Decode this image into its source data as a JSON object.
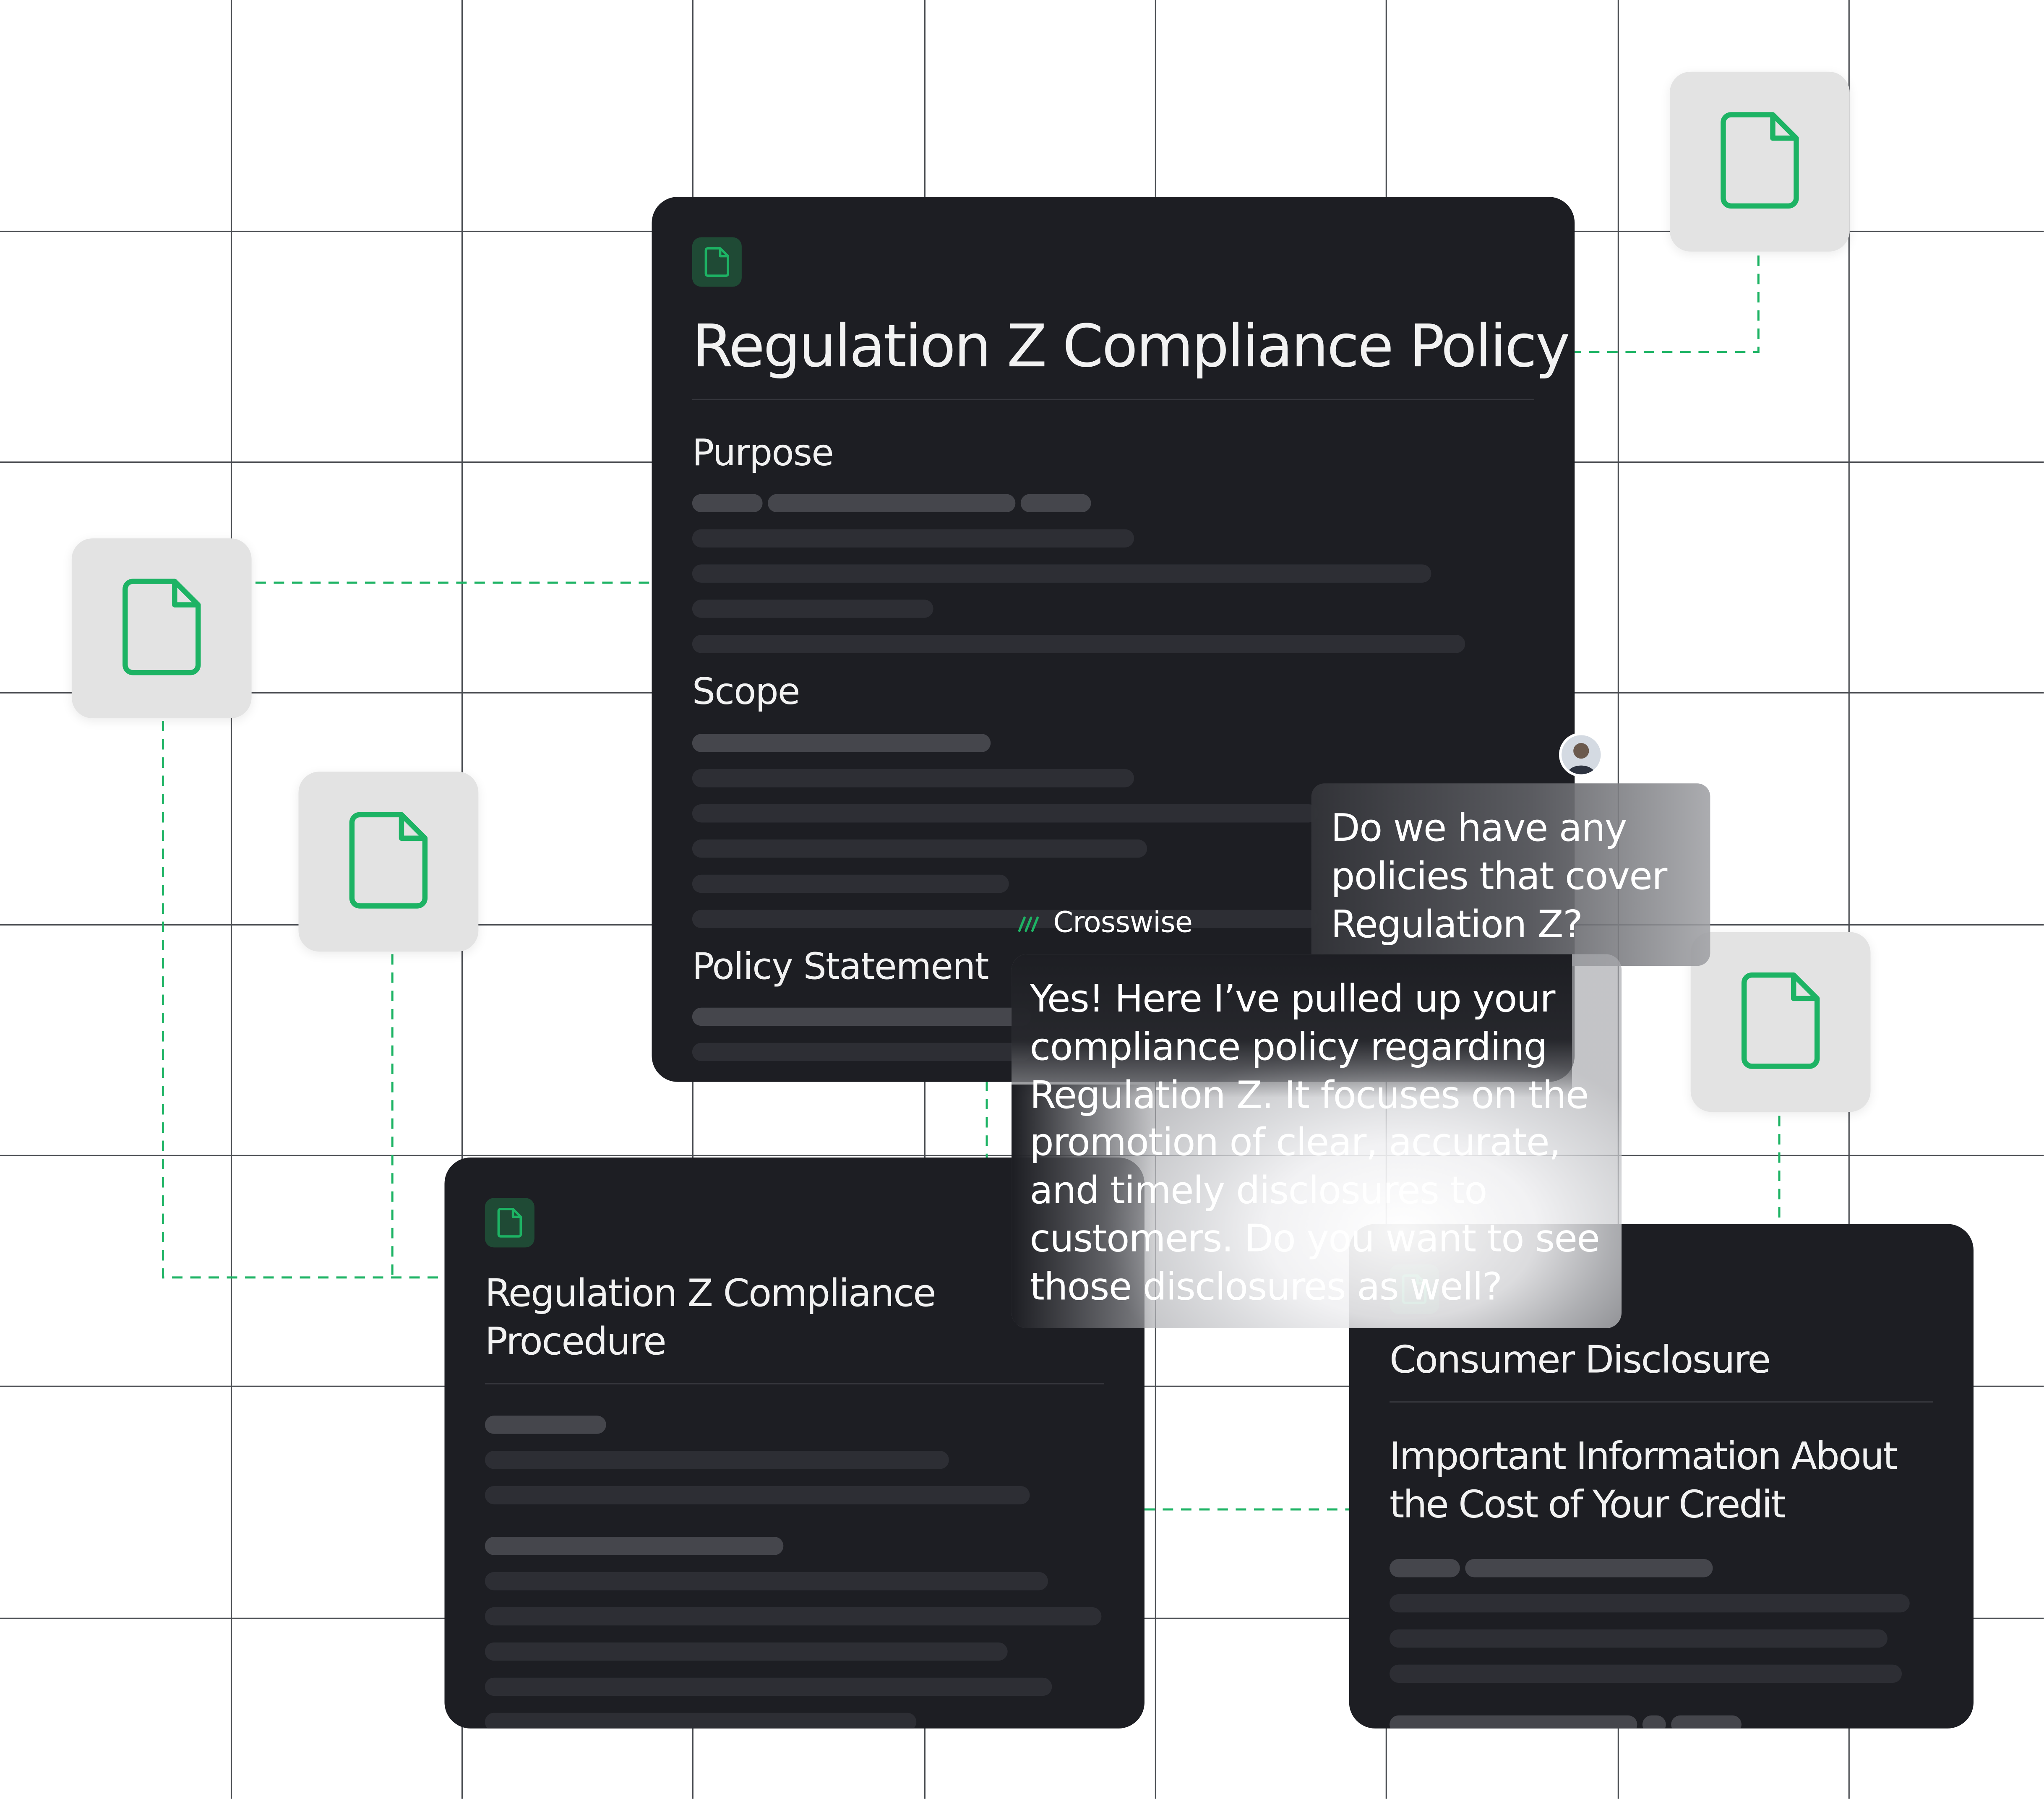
{
  "colors": {
    "accent": "#1db364",
    "card_bg": "#1d1e23",
    "tile_bg": "#e3e3e3",
    "grid": "#4a4d52"
  },
  "icons": {
    "tile": "document-icon",
    "badge": "document-icon",
    "brand": "crosswise-logo-icon"
  },
  "main_card": {
    "title": "Regulation Z Compliance Policy",
    "sections": [
      "Purpose",
      "Scope",
      "Policy Statement"
    ]
  },
  "procedure_card": {
    "title": "Regulation Z Compliance Procedure"
  },
  "disclosure_card": {
    "title": "Consumer Disclosure",
    "subtitle": "Important Information About the Cost of Your Credit"
  },
  "chat": {
    "user_message": "Do we have any policies that cover Regulation Z?",
    "assistant_name": "Crosswise",
    "assistant_message": "Yes! Here I’ve pulled up your compliance policy regarding Regulation Z. It focuses on the promotion of clear, accurate, and timely disclosures to customers. Do you want to see those disclosures as well?"
  }
}
